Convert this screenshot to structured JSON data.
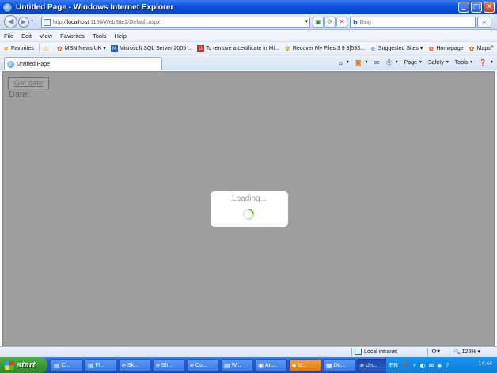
{
  "window": {
    "title": "Untitled Page - Windows Internet Explorer",
    "minimize": "_",
    "maximize": "□",
    "close": "✕"
  },
  "address": {
    "url_prefix": "http://",
    "url_host": "localhost",
    "url_rest": ":1166/WebSite2/Default.aspx",
    "dropdown": "▾"
  },
  "search": {
    "engine": "b",
    "placeholder": "Bing",
    "button": "⌕"
  },
  "menu": [
    "File",
    "Edit",
    "View",
    "Favorites",
    "Tools",
    "Help"
  ],
  "favorites": {
    "label": "Favorites",
    "items": [
      {
        "label": "MSN News UK ▾",
        "icon": "msn-butterfly-icon"
      },
      {
        "label": "Microsoft SQL Server 2005 ...",
        "icon": "msdn-icon"
      },
      {
        "label": "To remove a certificate in Mi...",
        "icon": "google-icon"
      },
      {
        "label": "Recover My Files 3 9 8[593...",
        "icon": "radiation-icon"
      },
      {
        "label": "Suggested Sites ▾",
        "icon": "ie-icon"
      },
      {
        "label": "Homepage",
        "icon": "msn-butterfly-icon"
      },
      {
        "label": "Maps",
        "icon": "msn-butterfly-icon"
      }
    ],
    "more": "»"
  },
  "tab": {
    "title": "Untitled Page"
  },
  "commands": [
    {
      "label": "",
      "icon": "home-icon"
    },
    {
      "label": "",
      "icon": "feeds-icon"
    },
    {
      "label": "",
      "icon": "mail-icon"
    },
    {
      "label": "",
      "icon": "print-icon"
    },
    {
      "label": "Page",
      "icon": ""
    },
    {
      "label": "Safety",
      "icon": ""
    },
    {
      "label": "Tools",
      "icon": ""
    },
    {
      "label": "",
      "icon": "help-icon"
    }
  ],
  "page": {
    "button_label": "Get date",
    "date_label": "Date:",
    "loading_text": "Loading..."
  },
  "status": {
    "zone": "Local intranet",
    "zoom": "125%"
  },
  "taskbar": {
    "start": "start",
    "tasks": [
      {
        "label": "C...",
        "icon": "folder-icon"
      },
      {
        "label": "Fi...",
        "icon": "folder-icon"
      },
      {
        "label": "Sk...",
        "icon": "ie-icon"
      },
      {
        "label": "Sh...",
        "icon": "ie-icon"
      },
      {
        "label": "Co...",
        "icon": "ie-icon"
      },
      {
        "label": "W...",
        "icon": "folder-icon"
      },
      {
        "label": "An...",
        "icon": "app-icon"
      },
      {
        "label": "S...",
        "icon": "app-icon"
      },
      {
        "label": "Do...",
        "icon": "doc-icon"
      },
      {
        "label": "Un...",
        "icon": "ie-icon"
      }
    ],
    "language": "EN",
    "clock": "14:44"
  }
}
